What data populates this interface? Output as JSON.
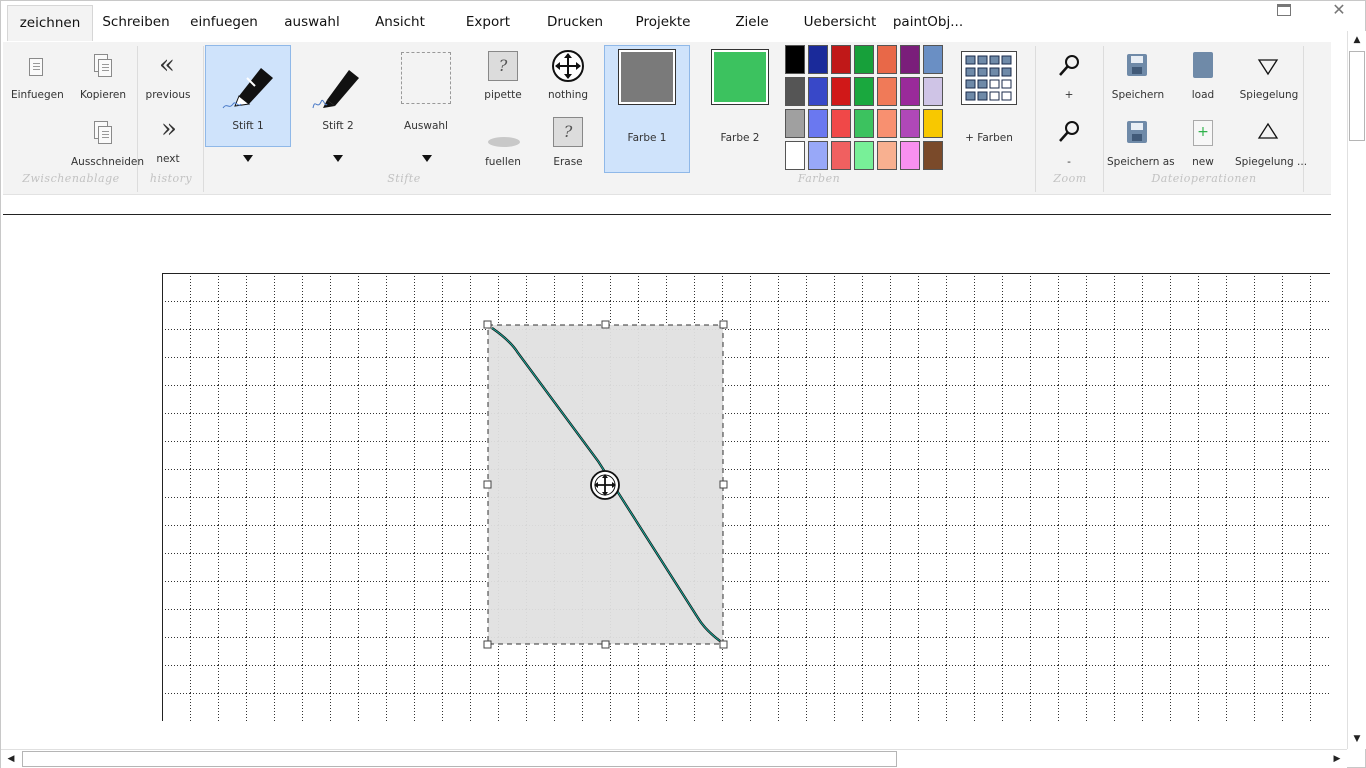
{
  "menu": {
    "tabs": [
      "zeichnen",
      "Schreiben",
      "einfuegen",
      "auswahl",
      "Ansicht",
      "Export",
      "Drucken",
      "Projekte",
      "Ziele",
      "Uebersicht",
      "paintObj..."
    ],
    "active": "zeichnen"
  },
  "ribbon": {
    "clipboard": {
      "group": "Zwischenablage",
      "paste": "Einfuegen",
      "copy": "Kopieren",
      "cut": "Ausschneiden"
    },
    "history": {
      "group": "history",
      "previous": "previous",
      "next": "next"
    },
    "pens": {
      "group": "Stifte",
      "pen1": "Stift 1",
      "pen2": "Stift 2",
      "selection": "Auswahl"
    },
    "tools": {
      "pipette": "pipette",
      "nothing": "nothing",
      "fill": "fuellen",
      "erase": "Erase",
      "question_mark": "?"
    },
    "colors": {
      "group": "Farben",
      "color1_label": "Farbe 1",
      "color1": "#7a7a7a",
      "color2_label": "Farbe 2",
      "color2": "#3cc25f",
      "more_colors": "+ Farben",
      "palette": [
        [
          "#000000",
          "#1a2a9a",
          "#c01818",
          "#17a03a",
          "#e86848",
          "#7a1e7a",
          "#6a8fc4"
        ],
        [
          "#555555",
          "#3848c8",
          "#d01818",
          "#1aa83e",
          "#f07a58",
          "#9a2a9a",
          "#cfc4e6"
        ],
        [
          "#a0a0a0",
          "#6a78f0",
          "#f04848",
          "#3cc25f",
          "#f89070",
          "#b048b8",
          "#f8c800"
        ],
        [
          "#ffffff",
          "#98a8f8",
          "#f06060",
          "#78f098",
          "#f8b090",
          "#f890f0",
          "#7a4a2a"
        ]
      ]
    },
    "zoom": {
      "group": "Zoom",
      "plus": "+",
      "minus": "-"
    },
    "file": {
      "group": "Dateioperationen",
      "save": "Speichern",
      "load": "load",
      "mirror": "Spiegelung",
      "save_as": "Speichern as",
      "new": "new",
      "mirror2": "Spiegelung ..."
    }
  }
}
